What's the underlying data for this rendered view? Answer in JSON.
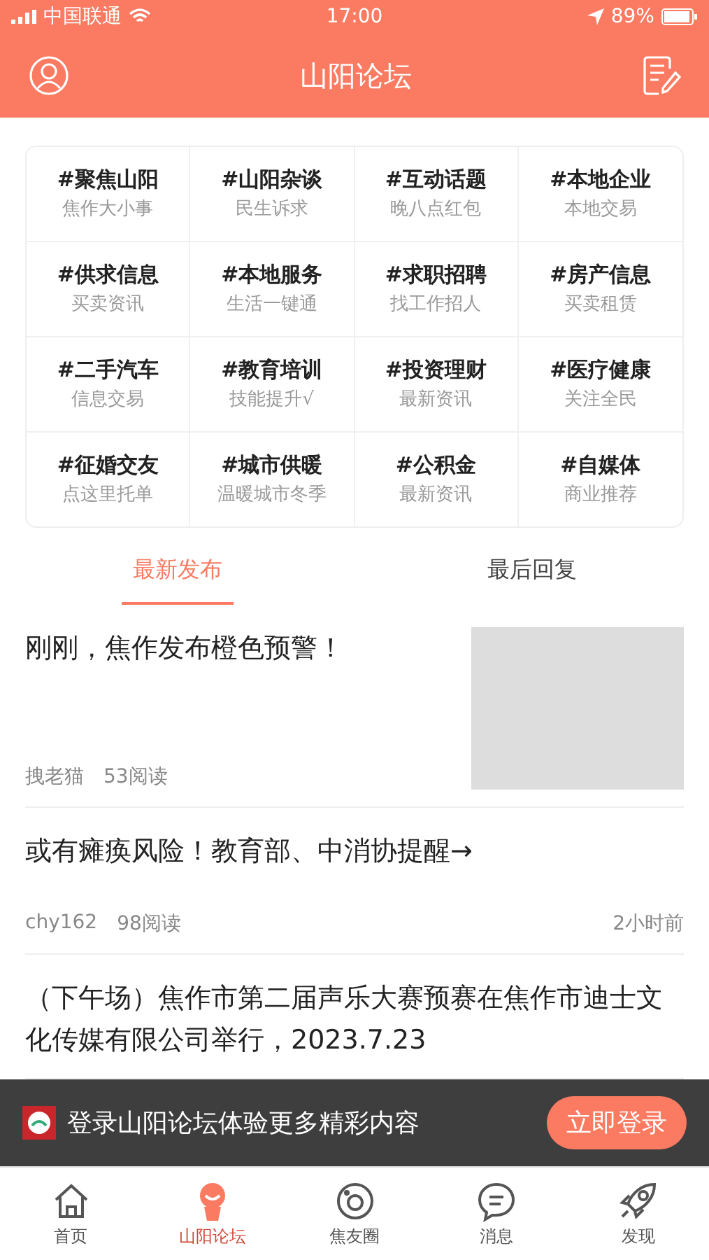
{
  "status_bar": {
    "carrier": "中国联通",
    "time": "17:00",
    "battery": "89%"
  },
  "header": {
    "title": "山阳论坛"
  },
  "topics": [
    {
      "title": "#聚焦山阳",
      "subtitle": "焦作大小事"
    },
    {
      "title": "#山阳杂谈",
      "subtitle": "民生诉求"
    },
    {
      "title": "#互动话题",
      "subtitle": "晚八点红包"
    },
    {
      "title": "#本地企业",
      "subtitle": "本地交易"
    },
    {
      "title": "#供求信息",
      "subtitle": "买卖资讯"
    },
    {
      "title": "#本地服务",
      "subtitle": "生活一键通"
    },
    {
      "title": "#求职招聘",
      "subtitle": "找工作招人"
    },
    {
      "title": "#房产信息",
      "subtitle": "买卖租赁"
    },
    {
      "title": "#二手汽车",
      "subtitle": "信息交易"
    },
    {
      "title": "#教育培训",
      "subtitle": "技能提升√"
    },
    {
      "title": "#投资理财",
      "subtitle": "最新资讯"
    },
    {
      "title": "#医疗健康",
      "subtitle": "关注全民"
    },
    {
      "title": "#征婚交友",
      "subtitle": "点这里托单"
    },
    {
      "title": "#城市供暖",
      "subtitle": "温暖城市冬季"
    },
    {
      "title": "#公积金",
      "subtitle": "最新资讯"
    },
    {
      "title": "#自媒体",
      "subtitle": "商业推荐"
    }
  ],
  "tabs": [
    {
      "label": "最新发布",
      "selected": true
    },
    {
      "label": "最后回复",
      "selected": false
    }
  ],
  "posts": [
    {
      "title": "刚刚，焦作发布橙色预警！",
      "author": "拽老猫",
      "reads": "53阅读",
      "has_image": true
    },
    {
      "title": "或有瘫痪风险！教育部、中消协提醒→",
      "author": "chy162",
      "reads": "98阅读",
      "time": "2小时前",
      "has_image": false
    },
    {
      "title": "（下午场）焦作市第二届声乐大赛预赛在焦作市迪士文化传媒有限公司举行，2023.7.23"
    }
  ],
  "login_banner": {
    "text": "登录山阳论坛体验更多精彩内容",
    "button": "立即登录"
  },
  "bottom_nav": [
    {
      "label": "首页",
      "kind": "home",
      "selected": false
    },
    {
      "label": "山阳论坛",
      "kind": "forum",
      "selected": true
    },
    {
      "label": "焦友圈",
      "kind": "circle",
      "selected": false
    },
    {
      "label": "消息",
      "kind": "message",
      "selected": false
    },
    {
      "label": "发现",
      "kind": "rocket",
      "selected": false
    }
  ]
}
